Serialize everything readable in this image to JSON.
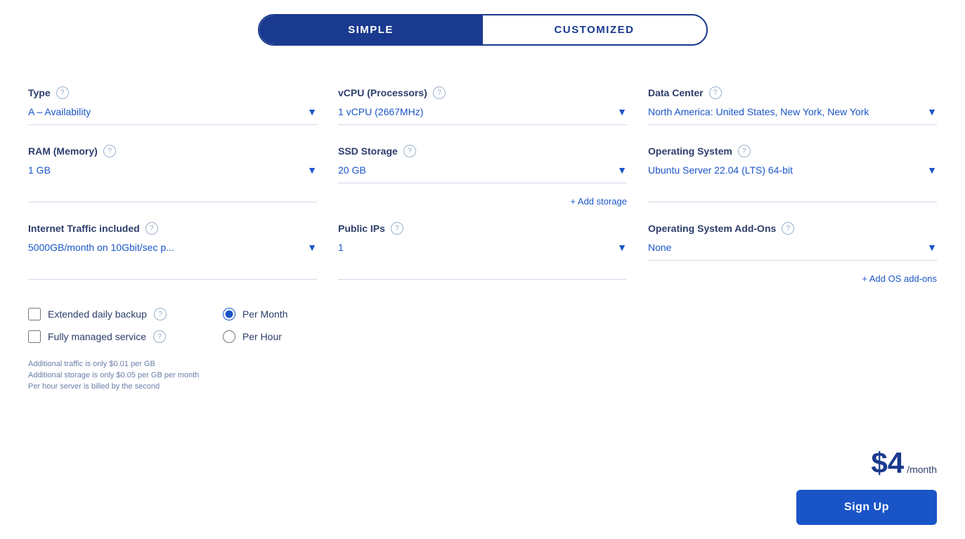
{
  "toggle": {
    "simple_label": "SIMPLE",
    "customized_label": "CUSTOMIZED"
  },
  "fields": {
    "type": {
      "label": "Type",
      "value": "A – Availability"
    },
    "vcpu": {
      "label": "vCPU (Processors)",
      "value": "1 vCPU (2667MHz)"
    },
    "data_center": {
      "label": "Data Center",
      "value": "North America: United States, New York, New York"
    },
    "ram": {
      "label": "RAM (Memory)",
      "value": "1 GB"
    },
    "ssd": {
      "label": "SSD Storage",
      "value": "20 GB"
    },
    "add_storage": "+ Add storage",
    "os": {
      "label": "Operating System",
      "value": "Ubuntu Server 22.04 (LTS) 64-bit"
    },
    "internet_traffic": {
      "label": "Internet Traffic included",
      "value": "5000GB/month on 10Gbit/sec p..."
    },
    "public_ips": {
      "label": "Public IPs",
      "value": "1"
    },
    "os_addons": {
      "label": "Operating System Add-Ons",
      "value": "None"
    },
    "add_os_addons": "+ Add OS add-ons"
  },
  "checkboxes": [
    {
      "label": "Extended daily backup",
      "checked": false
    },
    {
      "label": "Fully managed service",
      "checked": false
    }
  ],
  "radios": [
    {
      "label": "Per Month",
      "checked": true
    },
    {
      "label": "Per Hour",
      "checked": false
    }
  ],
  "notes": [
    "Additional traffic is only $0.01 per GB",
    "Additional storage is only $0.05 per GB per month",
    "Per hour server is billed by the second"
  ],
  "price": {
    "amount": "$4",
    "period": "/month"
  },
  "signup_label": "Sign Up"
}
